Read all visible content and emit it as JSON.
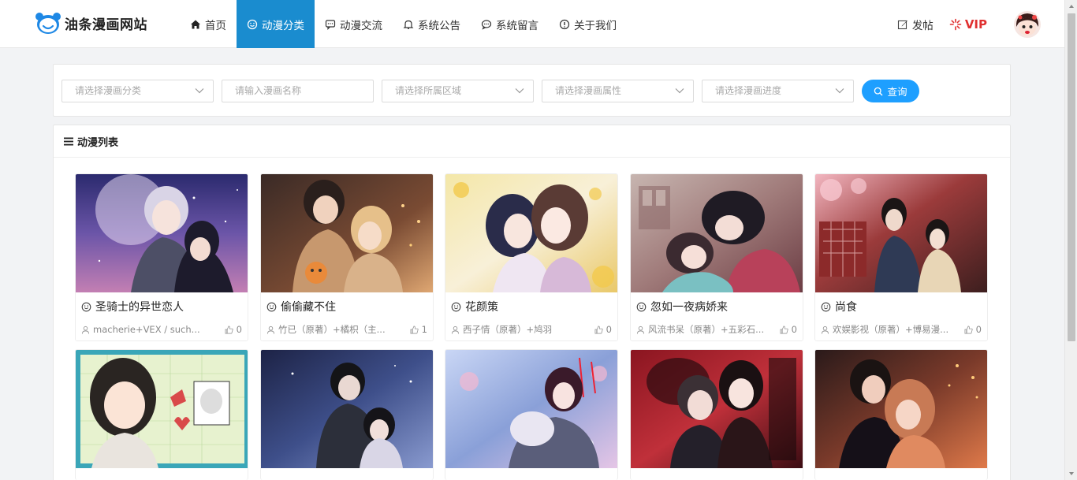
{
  "site": {
    "name": "油条漫画网站"
  },
  "nav": {
    "items": [
      {
        "label": "首页",
        "icon": "home-icon"
      },
      {
        "label": "动漫分类",
        "icon": "smile-icon",
        "active": true
      },
      {
        "label": "动漫交流",
        "icon": "chat-icon"
      },
      {
        "label": "系统公告",
        "icon": "bell-icon"
      },
      {
        "label": "系统留言",
        "icon": "message-icon"
      },
      {
        "label": "关于我们",
        "icon": "info-icon"
      }
    ],
    "post_label": "发帖",
    "vip_label": "VIP"
  },
  "filters": {
    "category_placeholder": "请选择漫画分类",
    "name_placeholder": "请输入漫画名称",
    "region_placeholder": "请选择所属区域",
    "attribute_placeholder": "请选择漫画属性",
    "progress_placeholder": "请选择漫画进度",
    "query_label": "查询"
  },
  "list": {
    "title": "动漫列表",
    "cards": [
      {
        "title": "圣骑士的异世恋人",
        "author": "macherie+VEX / such...",
        "likes": "0"
      },
      {
        "title": "偷偷藏不住",
        "author": "竹已（原著）+橘枳（主...",
        "likes": "1"
      },
      {
        "title": "花颜策",
        "author": "西子情（原著）+鸠羽",
        "likes": "0"
      },
      {
        "title": "忽如一夜病娇来",
        "author": "风流书呆（原著）+五彩石...",
        "likes": "0"
      },
      {
        "title": "尚食",
        "author": "欢娱影视（原著）+博易漫...",
        "likes": "0"
      },
      {
        "title": "",
        "author": "",
        "likes": ""
      },
      {
        "title": "",
        "author": "",
        "likes": ""
      },
      {
        "title": "",
        "author": "",
        "likes": ""
      },
      {
        "title": "",
        "author": "",
        "likes": ""
      },
      {
        "title": "",
        "author": "",
        "likes": ""
      }
    ]
  },
  "colors": {
    "accent": "#1a8ccf",
    "query": "#1e9fff",
    "vip": "#e03030"
  }
}
